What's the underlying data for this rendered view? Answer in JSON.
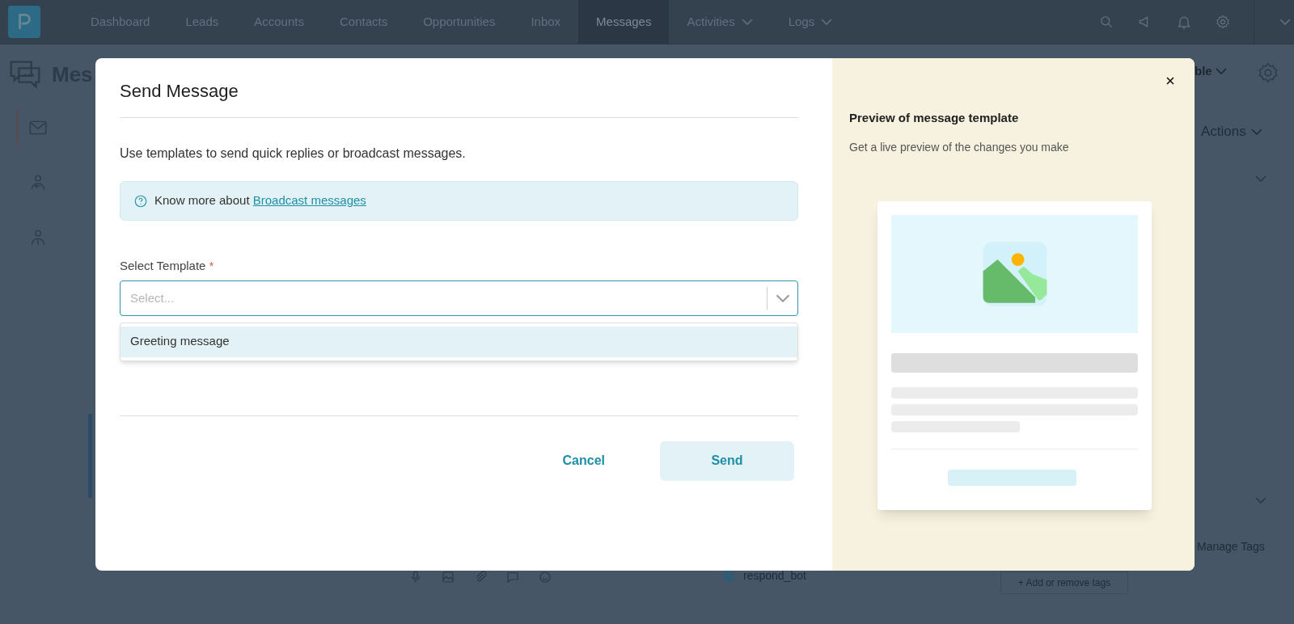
{
  "nav": {
    "items": [
      {
        "label": "Dashboard",
        "selected": false,
        "has_menu": false
      },
      {
        "label": "Leads",
        "selected": false,
        "has_menu": false
      },
      {
        "label": "Accounts",
        "selected": false,
        "has_menu": false
      },
      {
        "label": "Contacts",
        "selected": false,
        "has_menu": false
      },
      {
        "label": "Opportunities",
        "selected": false,
        "has_menu": false
      },
      {
        "label": "Inbox",
        "selected": false,
        "has_menu": false
      },
      {
        "label": "Messages",
        "selected": true,
        "has_menu": false
      },
      {
        "label": "Activities",
        "selected": false,
        "has_menu": true
      },
      {
        "label": "Logs",
        "selected": false,
        "has_menu": true
      }
    ]
  },
  "page": {
    "title": "Mes",
    "view_label": "ble",
    "actions_label": "Actions",
    "manage_tags": "Manage Tags",
    "add_tags": "+ Add or remove tags",
    "channel": "respond_bot",
    "sidebar": [
      {
        "kind": "mail",
        "selected": true
      },
      {
        "kind": "person-in",
        "selected": false
      },
      {
        "kind": "person-info",
        "selected": false
      }
    ]
  },
  "modal": {
    "title": "Send Message",
    "description": "Use templates to send quick replies or broadcast messages.",
    "info": {
      "text": "Know more about",
      "link": "Broadcast messages"
    },
    "field": {
      "label": "Select Template",
      "required": true,
      "required_mark": "*",
      "placeholder": "Select..."
    },
    "options": [
      {
        "label": "Greeting message",
        "selected": true
      }
    ],
    "cancel": "Cancel",
    "send": "Send",
    "preview": {
      "title": "Preview of message template",
      "subtitle": "Get a live preview of the changes you make"
    }
  }
}
